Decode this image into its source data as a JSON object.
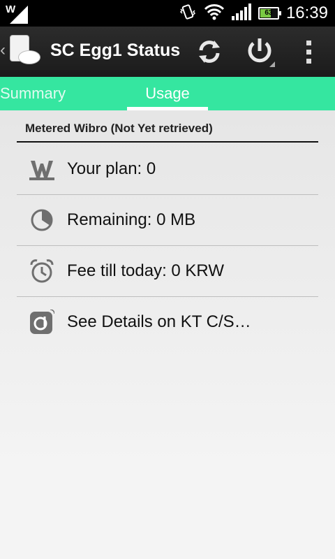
{
  "status_bar": {
    "time": "16:39",
    "battery": "63",
    "battery_level": 0.63,
    "icons": [
      "w-logo-icon",
      "signal-icon",
      "vibrate-icon",
      "wifi-icon",
      "cell-signal-icon",
      "battery-icon"
    ]
  },
  "action_bar": {
    "title": "SC Egg1 Status",
    "icons": [
      "back-chevron-icon",
      "app-icon",
      "refresh-icon",
      "power-icon",
      "overflow-menu-icon"
    ]
  },
  "tabs": [
    {
      "label": "Summary",
      "selected": false
    },
    {
      "label": "Usage",
      "selected": true
    }
  ],
  "colors": {
    "tab_bar": "#35e6a0",
    "action_bar": "#222222",
    "status_bar": "#000000"
  },
  "usage": {
    "header": "Metered Wibro (Not Yet retrieved)",
    "rows": [
      {
        "icon": "wibro-w-icon",
        "label": "Your plan: 0"
      },
      {
        "icon": "pie-clock-icon",
        "label": "Remaining: 0 MB"
      },
      {
        "icon": "alarm-clock-icon",
        "label": "Fee till today: 0 KRW"
      },
      {
        "icon": "olleh-logo-icon",
        "label": "See Details on KT C/S…"
      }
    ]
  }
}
